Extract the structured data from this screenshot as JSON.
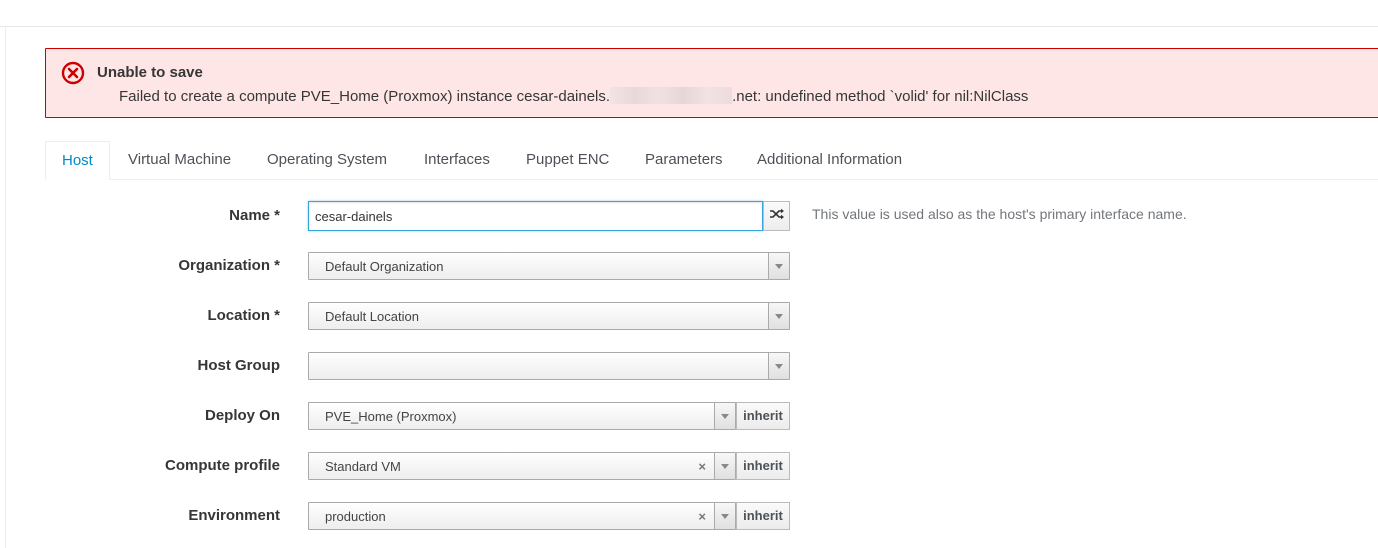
{
  "alert": {
    "title": "Unable to save",
    "message_prefix": "Failed to create a compute PVE_Home (Proxmox) instance cesar-dainels.",
    "message_suffix": ".net: undefined method `volid' for nil:NilClass",
    "icon": "error-circle-icon",
    "color": "#cc0000"
  },
  "tabs": [
    {
      "label": "Host",
      "active": true
    },
    {
      "label": "Virtual Machine"
    },
    {
      "label": "Operating System"
    },
    {
      "label": "Interfaces"
    },
    {
      "label": "Puppet ENC"
    },
    {
      "label": "Parameters"
    },
    {
      "label": "Additional Information"
    }
  ],
  "form": {
    "name": {
      "label": "Name *",
      "value": "cesar-dainels",
      "help": "This value is used also as the host's primary interface name.",
      "shuffle_icon": "shuffle-icon"
    },
    "organization": {
      "label": "Organization *",
      "value": "Default Organization"
    },
    "location": {
      "label": "Location *",
      "value": "Default Location"
    },
    "host_group": {
      "label": "Host Group",
      "value": ""
    },
    "deploy_on": {
      "label": "Deploy On",
      "value": "PVE_Home (Proxmox)",
      "inherit": "inherit"
    },
    "compute_profile": {
      "label": "Compute profile",
      "value": "Standard VM",
      "clear": "×",
      "inherit": "inherit"
    },
    "environment": {
      "label": "Environment",
      "value": "production",
      "clear": "×",
      "inherit": "inherit"
    }
  },
  "colors": {
    "accent": "#0088ce",
    "error_bg": "#ffe6e6",
    "focus": "#39a5dc"
  }
}
